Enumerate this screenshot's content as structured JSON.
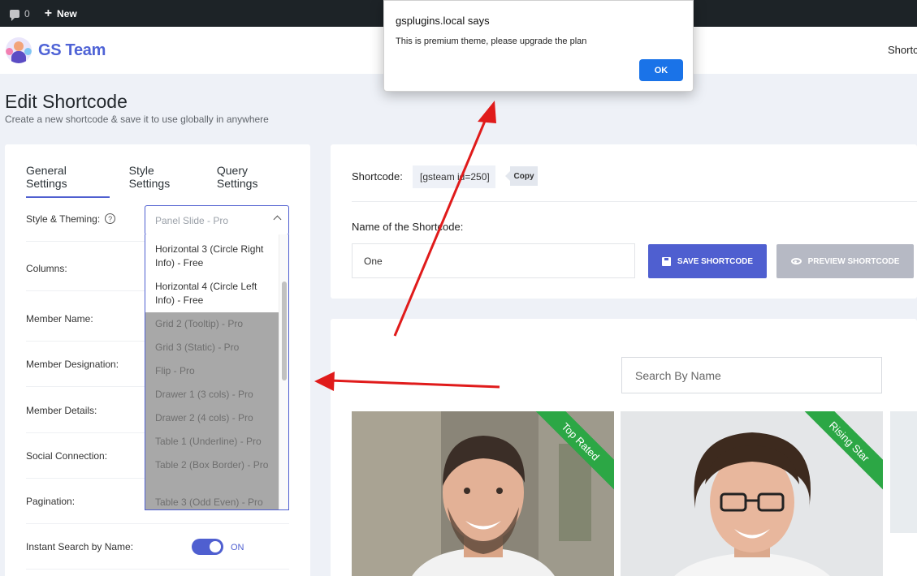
{
  "admin_bar": {
    "comments_count": "0",
    "new_label": "New"
  },
  "header": {
    "logo_text": "GS Team",
    "right_link": "Shortcodes"
  },
  "page": {
    "title": "Edit Shortcode",
    "subtitle": "Create a new shortcode & save it to use globally in anywhere"
  },
  "tabs": [
    "General Settings",
    "Style Settings",
    "Query Settings"
  ],
  "settings": {
    "style_theming_label": "Style & Theming:",
    "selected_theme": "Panel Slide - Pro",
    "rows": [
      "Columns:",
      "Member Name:",
      "Member Designation:",
      "Member Details:",
      "Social Connection:",
      "Pagination:",
      "Instant Search by Name:"
    ],
    "instant_search_toggle": "ON"
  },
  "dropdown": {
    "free_options": [
      "Horizontal 3 (Circle Right Info) - Free",
      "Horizontal 4 (Circle Left Info) - Free"
    ],
    "pro_options": [
      "Grid 2 (Tooltip) - Pro",
      "Grid 3 (Static) - Pro",
      "Flip - Pro",
      "Drawer 1 (3 cols) - Pro",
      "Drawer 2 (4 cols) - Pro",
      "Table 1 (Underline) - Pro",
      "Table 2 (Box Border) - Pro",
      "Table 3 (Odd Even) - Pro"
    ]
  },
  "shortcode": {
    "label": "Shortcode:",
    "code": "[gsteam id=250]",
    "copy_label": "Copy",
    "name_label": "Name of the Shortcode:",
    "name_value": "One",
    "save_button": "SAVE SHORTCODE",
    "preview_button": "PREVIEW SHORTCODE"
  },
  "preview": {
    "search_placeholder": "Search By Name",
    "ribbons": [
      "Top Rated",
      "Rising Star"
    ]
  },
  "alert": {
    "title": "gsplugins.local says",
    "message": "This is premium theme, please upgrade the plan",
    "ok_label": "OK"
  },
  "colors": {
    "accent": "#4f5fd0",
    "ribbon": "#2ca745",
    "annotation_arrow": "#e01b1b",
    "alert_button": "#1a73e8"
  }
}
